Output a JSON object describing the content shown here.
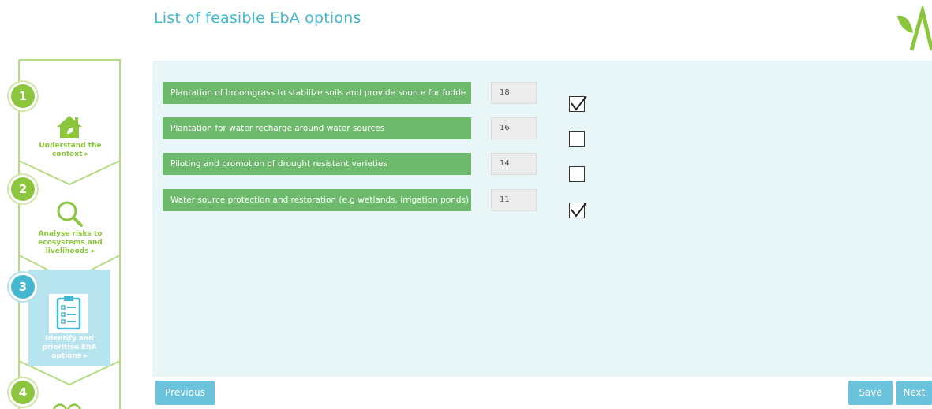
{
  "page": {
    "title": "List of feasible EbA options"
  },
  "sidebar": {
    "steps": [
      {
        "number": "1",
        "label": "Understand the context",
        "line1": "Understand the",
        "line2": "context",
        "icon": "house-icon"
      },
      {
        "number": "2",
        "label": "Analyse risks to ecosystems and livelihoods",
        "line1": "Analyse risks to",
        "line2": "ecosystems and",
        "line3": "livelihoods",
        "icon": "magnifier-icon"
      },
      {
        "number": "3",
        "label": "Identify and prioritise EbA options",
        "line1": "Identify and",
        "line2": "prioritise EbA",
        "line3": "options",
        "icon": "clipboard-icon"
      },
      {
        "number": "4",
        "label": "",
        "icon": "waves-icon"
      }
    ]
  },
  "options": [
    {
      "label": "Plantation of broomgrass to stabilize soils and provide source for fodde",
      "score": "18",
      "checked": true
    },
    {
      "label": "Plantation for water recharge around water sources",
      "score": "16",
      "checked": false
    },
    {
      "label": "Piloting and promotion of drought resistant varieties",
      "score": "14",
      "checked": false
    },
    {
      "label": "Water source protection and restoration (e.g wetlands, irrigation ponds)",
      "score": "11",
      "checked": true
    }
  ],
  "buttons": {
    "previous": "Previous",
    "save": "Save",
    "next": "Next"
  },
  "colors": {
    "accent": "#45b8cf",
    "green": "#8cc63f",
    "option_bg": "#6dba6c",
    "button": "#6cc4dc"
  }
}
